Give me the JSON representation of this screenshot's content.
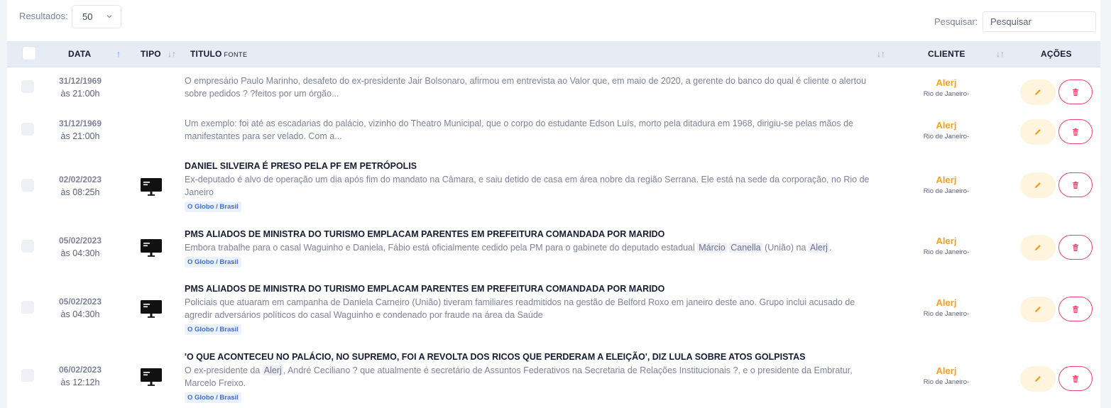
{
  "controls": {
    "results_label": "Resultados:",
    "results_value": "50",
    "search_label": "Pesquisar:",
    "search_placeholder": "Pesquisar"
  },
  "columns": {
    "data": "DATA",
    "tipo": "TIPO",
    "titulo": "TITULO",
    "fonte": "FONTE",
    "cliente": "CLIENTE",
    "acoes": "AÇÕES"
  },
  "rows": [
    {
      "date": "31/12/1969",
      "time": "às 21:00h",
      "type_icon": "monitor-icon",
      "title": "",
      "snippet": "O empresário Paulo Marinho, desafeto do ex-presidente Jair Bolsonaro, afirmou em entrevista ao Valor que, em maio de 2020, a gerente do banco do qual é cliente o alertou sobre pedidos ? ?feitos por um órgão...",
      "source": "",
      "client": "Alerj",
      "client_city": "Rio de Janeiro-"
    },
    {
      "date": "31/12/1969",
      "time": "às 21:00h",
      "type_icon": "monitor-icon",
      "title": "",
      "snippet": "Um exemplo: foi até as escadarias do palácio, vizinho do Theatro Municipal, que o corpo do estudante Edson Luís, morto pela ditadura em 1968, dirigiu-se pelas mãos de manifestantes para ser velado. Com a...",
      "source": "",
      "client": "Alerj",
      "client_city": "Rio de Janeiro-"
    },
    {
      "date": "02/02/2023",
      "time": "às 08:25h",
      "type_icon": "monitor-icon",
      "title": "DANIEL SILVEIRA É PRESO PELA PF EM PETRÓPOLIS",
      "snippet": "Ex-deputado é alvo de operação um dia após fim do mandato na Câmara, e saiu detido de casa em área nobre da região Serrana. Ele está na sede da corporação, no Rio de Janeiro",
      "source": "O Globo / Brasil",
      "client": "Alerj",
      "client_city": "Rio de Janeiro-"
    },
    {
      "date": "05/02/2023",
      "time": "às 04:30h",
      "type_icon": "monitor-icon",
      "title": "PMS ALIADOS DE MINISTRA DO TURISMO EMPLACAM PARENTES EM PREFEITURA COMANDADA POR MARIDO",
      "snippet_parts": [
        {
          "text": "Embora trabalhe para o casal Waguinho e Daniela, Fábio está oficialmente cedido pela PM para o gabinete do deputado estadual ",
          "hl": false
        },
        {
          "text": "Márcio",
          "hl": true
        },
        {
          "text": " ",
          "hl": false
        },
        {
          "text": "Canella",
          "hl": true
        },
        {
          "text": " (União) na ",
          "hl": false
        },
        {
          "text": "Alerj",
          "hl": true
        },
        {
          "text": ".",
          "hl": false
        }
      ],
      "source": "O Globo / Brasil",
      "client": "Alerj",
      "client_city": "Rio de Janeiro-"
    },
    {
      "date": "05/02/2023",
      "time": "às 04:30h",
      "type_icon": "monitor-icon",
      "title": "PMS ALIADOS DE MINISTRA DO TURISMO EMPLACAM PARENTES EM PREFEITURA COMANDADA POR MARIDO",
      "snippet": "Policiais que atuaram em campanha de Daniela Carneiro (União) tiveram familiares readmitidos na gestão de Belford Roxo em janeiro deste ano. Grupo inclui acusado de agredir adversários políticos do casal Waguinho e condenado por fraude na área da Saúde",
      "source": "O Globo / Brasil",
      "client": "Alerj",
      "client_city": "Rio de Janeiro-"
    },
    {
      "date": "06/02/2023",
      "time": "às 12:12h",
      "type_icon": "monitor-icon",
      "title": "'O QUE ACONTECEU NO PALÁCIO, NO SUPREMO, FOI A REVOLTA DOS RICOS QUE PERDERAM A ELEIÇÃO', DIZ LULA SOBRE ATOS GOLPISTAS",
      "snippet_parts": [
        {
          "text": "O ex-presidente da ",
          "hl": false
        },
        {
          "text": "Alerj",
          "hl": true
        },
        {
          "text": ", André Ceciliano ? que atualmente é secretário de Assuntos Federativos na Secretaria de Relações Institucionais ?, e o presidente da Embratur, Marcelo Freixo.",
          "hl": false
        }
      ],
      "source": "O Globo / Brasil",
      "client": "Alerj",
      "client_city": "Rio de Janeiro-"
    }
  ],
  "colors": {
    "client": "#f4a020",
    "edit_bg": "#fff4de",
    "delete_border": "#f1416c",
    "header_bg": "#e7ebf4",
    "source_badge": "#3e6fd6"
  }
}
